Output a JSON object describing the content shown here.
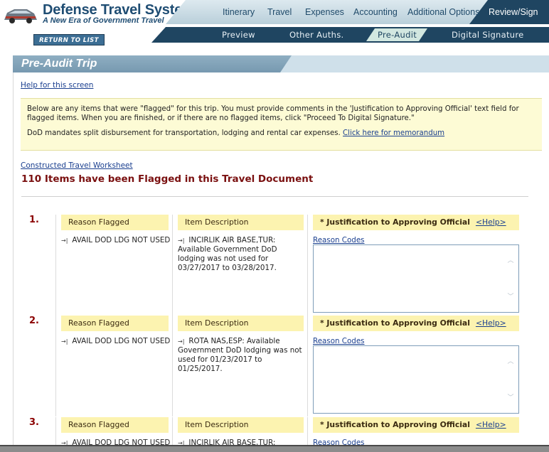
{
  "brand": {
    "title": "Defense Travel System",
    "subtitle": "A New Era of Government Travel"
  },
  "header": {
    "return_label": "RETURN TO LIST",
    "main_tabs": [
      {
        "label": "Itinerary",
        "active": false
      },
      {
        "label": "Travel",
        "active": false
      },
      {
        "label": "Expenses",
        "active": false
      },
      {
        "label": "Accounting",
        "active": false
      },
      {
        "label": "Additional Options",
        "active": false
      },
      {
        "label": "Review/Sign",
        "active": true
      }
    ],
    "sub_tabs": [
      {
        "label": "Preview",
        "active": false
      },
      {
        "label": "Other Auths.",
        "active": false
      },
      {
        "label": "Pre-Audit",
        "active": true
      },
      {
        "label": "Digital Signature",
        "active": false
      }
    ]
  },
  "page": {
    "title": "Pre-Audit Trip",
    "help_link": "Help for this screen",
    "notice": {
      "line1": "Below are any items that were \"flagged\" for this trip. You must provide comments in the 'Justification to Approving Official' text field for flagged items. When you are finished, or if there are no flagged items, click \"Proceed To Digital Signature.\"",
      "line2_text": "DoD mandates split disbursement for transportation, lodging and rental car expenses.",
      "line2_link": "Click here for memorandum"
    },
    "worksheet_link": "Constructed Travel Worksheet",
    "flag_heading": "110 Items have been Flagged in this Travel Document"
  },
  "columns": {
    "reason": "Reason Flagged",
    "description": "Item Description",
    "justification": "* Justification to Approving Official",
    "help": "<Help>",
    "codes": "Reason Codes"
  },
  "items": [
    {
      "num": "1.",
      "reason": "AVAIL DOD LDG NOT USED",
      "description": "INCIRLIK AIR BASE,TUR: Available Government DoD lodging was not used for 03/27/2017 to 03/28/2017.",
      "justification": ""
    },
    {
      "num": "2.",
      "reason": "AVAIL DOD LDG NOT USED",
      "description": "ROTA NAS,ESP: Available Government DoD lodging was not used for 01/23/2017 to 01/25/2017.",
      "justification": ""
    },
    {
      "num": "3.",
      "reason": "AVAIL DOD LDG NOT USED",
      "description": "INCIRLIK AIR BASE,TUR:",
      "justification": ""
    }
  ],
  "colors": {
    "navy": "#1f4561",
    "brand_blue": "#1f4d73",
    "header_yellow": "#fcf3b0",
    "notice_yellow": "#fdfbd5",
    "flag_red": "#7a1010",
    "link_blue": "#1a3f8f"
  },
  "icons": {
    "logo": "car-logo-icon",
    "row_bullet": "arrow-bar-icon",
    "scroll_up": "chevron-up-icon",
    "scroll_down": "chevron-down-icon"
  }
}
